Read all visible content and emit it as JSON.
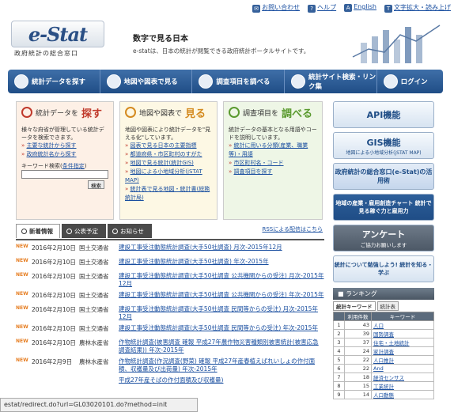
{
  "util": {
    "contact": "お問い合わせ",
    "help": "ヘルプ",
    "english": "English",
    "textsize": "文字拡大・読み上げ"
  },
  "header": {
    "logo_main": "e-Stat",
    "logo_sub": "政府統計の総合窓口",
    "tagline1": "数字で見る日本",
    "tagline2": "e-statは、日本の統計が閲覧できる政府統計ポータルサイトです。"
  },
  "nav": [
    "統計データを探す",
    "地図や図表で見る",
    "調査項目を調べる",
    "統計サイト検索・リンク集",
    "ログイン"
  ],
  "box1": {
    "title_prefix": "統計データを",
    "title_main": "探す",
    "desc": "様々な府省が管理している統計データを検索できます。",
    "links": [
      "主要な統計から探す",
      "政府統計名から探す"
    ],
    "kw_label": "キーワード検索(",
    "kw_link": "条件指定",
    "kw_close": ")",
    "search_button": "検索"
  },
  "box2": {
    "title_prefix": "地図や図表で",
    "title_main": "見る",
    "desc": "地図や図表により統計データを\"見える化\"しています。",
    "links": [
      "図表で見る日本の主要指標",
      "都道府県・市区町村のすがた",
      "地図で見る統計(統計GIS)",
      "地図による小地域分析(jSTAT MAP)",
      "統計表で見る地図・統計書(総務統計局)"
    ]
  },
  "box3": {
    "title_prefix": "調査項目を",
    "title_main": "調べる",
    "desc": "統計データの基本となる用語やコードを説明しています。",
    "links": [
      "統計に用いる分類(産業、職業等)・用語",
      "市区町村名・コード",
      "調査項目を探す"
    ]
  },
  "tabs": {
    "t1": "新着情報",
    "t2": "公表予定",
    "t3": "お知らせ",
    "rss": "RSSによる配信はこちら"
  },
  "news": [
    {
      "new": "NEW",
      "date": "2016年2月10日",
      "agency": "国土交通省",
      "title": "建設工事受注動態統計調査(大手50社調査) 月次-2015年12月"
    },
    {
      "new": "NEW",
      "date": "2016年2月10日",
      "agency": "国土交通省",
      "title": "建設工事受注動態統計調査(大手50社調査) 年次-2015年"
    },
    {
      "new": "NEW",
      "date": "2016年2月10日",
      "agency": "国土交通省",
      "title": "建設工事受注動態統計調査(大手50社調査 公共機関からの受注) 月次-2015年12月"
    },
    {
      "new": "NEW",
      "date": "2016年2月10日",
      "agency": "国土交通省",
      "title": "建設工事受注動態統計調査(大手50社調査 公共機関からの受注) 年次-2015年"
    },
    {
      "new": "NEW",
      "date": "2016年2月10日",
      "agency": "国土交通省",
      "title": "建設工事受注動態統計調査(大手50社調査 民間等からの受注) 月次-2015年12月"
    },
    {
      "new": "NEW",
      "date": "2016年2月10日",
      "agency": "国土交通省",
      "title": "建設工事受注動態統計調査(大手50社調査 民間等からの受注) 年次-2015年"
    },
    {
      "new": "NEW",
      "date": "2016年2月10日",
      "agency": "農林水産省",
      "title": "作物統計調査(被害調査 確報 平成27年農作物災害種類別被害統計(被害応急調査結果)) 年次-2015年"
    },
    {
      "new": "NEW",
      "date": "2016年2月9日",
      "agency": "農林水産省",
      "title": "作物統計調査(作況調査(野菜) 確報 平成27年産春植えばれいしょの作付面積、収穫量及び出荷量) 年次-2015年"
    },
    {
      "new": "",
      "date": "",
      "agency": "",
      "title": "平成27年産そばの作付面積及び収穫量)"
    }
  ],
  "side": {
    "api": "API機能",
    "gis": "GIS機能",
    "gis_sub": "地図による小地域分析(jSTAT MAP)",
    "portal": "政府統計の総合窓口(e-Stat)の活用術",
    "chart": "地域の産業・雇用創造チャート 統計で見る稼ぐ力と雇用力",
    "survey": "アンケート",
    "survey_sub": "ご協力お願いします",
    "learn": "統計について勉強しよう! 統計を知る・学ぶ"
  },
  "ranking": {
    "title": "ランキング",
    "tab1": "統計キーワード",
    "tab2": "統計表",
    "col_rank": "",
    "col_count": "利用件数",
    "col_kw": "キーワード",
    "rows": [
      {
        "n": "1",
        "c": "43",
        "k": "人口"
      },
      {
        "n": "2",
        "c": "39",
        "k": "国勢調査"
      },
      {
        "n": "3",
        "c": "37",
        "k": "住宅・土地統計"
      },
      {
        "n": "4",
        "c": "24",
        "k": "家計調査"
      },
      {
        "n": "5",
        "c": "22",
        "k": "人口推計"
      },
      {
        "n": "6",
        "c": "22",
        "k": "And"
      },
      {
        "n": "7",
        "c": "18",
        "k": "経済センサス"
      },
      {
        "n": "8",
        "c": "15",
        "k": "工業統計"
      },
      {
        "n": "9",
        "c": "14",
        "k": "人口動態"
      }
    ]
  },
  "status": "estat/redirect.do?url=GL03020101.do?method=init",
  "colors": {
    "nav": "#1f4d86",
    "box1_bg": "#fdf0e6",
    "box2_bg": "#fdf8e4",
    "box3_bg": "#eef6e6",
    "accent_red": "#c0392b"
  }
}
